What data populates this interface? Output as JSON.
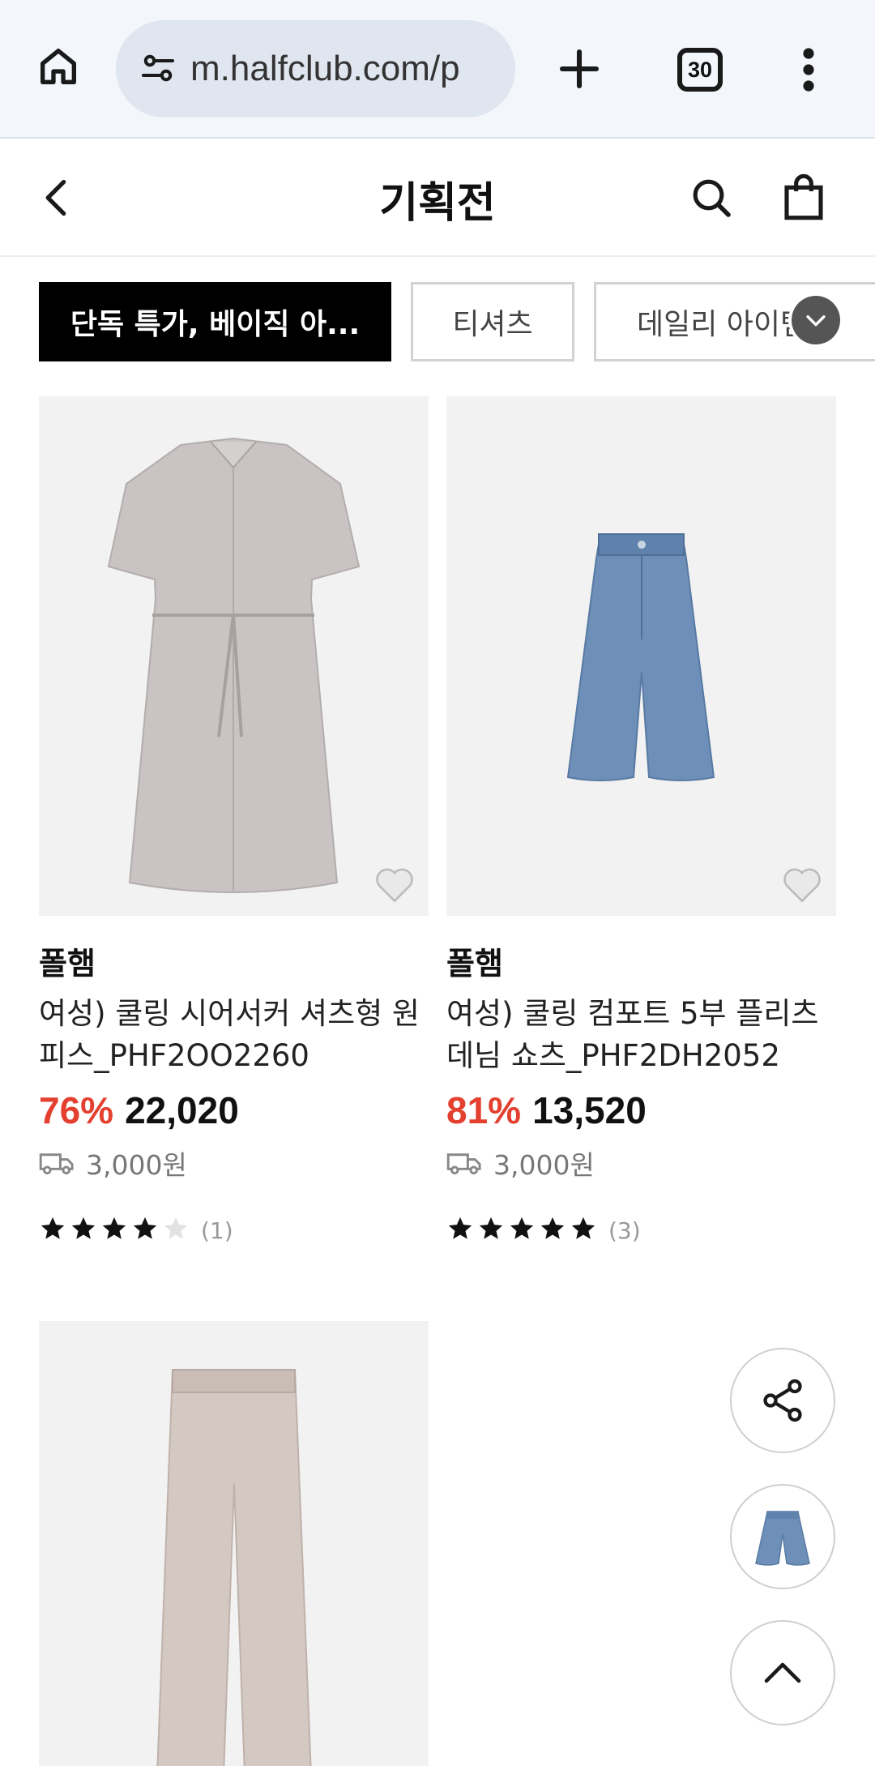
{
  "browser": {
    "url": "m.halfclub.com/p",
    "tab_count": "30",
    "icons": [
      "home-icon",
      "tune-icon",
      "plus-icon",
      "tab-switcher-icon",
      "more-vert-icon"
    ]
  },
  "header": {
    "title": "기획전",
    "icons": [
      "chevron-left-icon",
      "search-icon",
      "shopping-bag-icon"
    ]
  },
  "chips": {
    "active": "단독 특가, 베이직 아...",
    "second": "티셔츠",
    "third": "데일리 아이템",
    "expand_icon": "chevron-down-icon"
  },
  "products": [
    {
      "brand": "폴햄",
      "name": "여성) 쿨링 시어서커 셔츠형 원피스_PHF2OO2260",
      "discount": "76%",
      "price": "22,020",
      "shipping": "3,000원",
      "rating": 4,
      "review_count": "(1)"
    },
    {
      "brand": "폴햄",
      "name": "여성) 쿨링 컴포트 5부 플리츠 데님 쇼츠_PHF2DH2052",
      "discount": "81%",
      "price": "13,520",
      "shipping": "3,000원",
      "rating": 5,
      "review_count": "(3)"
    }
  ],
  "floating": {
    "icons": [
      "share-icon",
      "recent-item-thumbnail",
      "chevron-up-icon"
    ]
  },
  "colors": {
    "discount": "#e4402f",
    "chip_active_bg": "#000000",
    "browser_bar": "#f3f6fb"
  }
}
